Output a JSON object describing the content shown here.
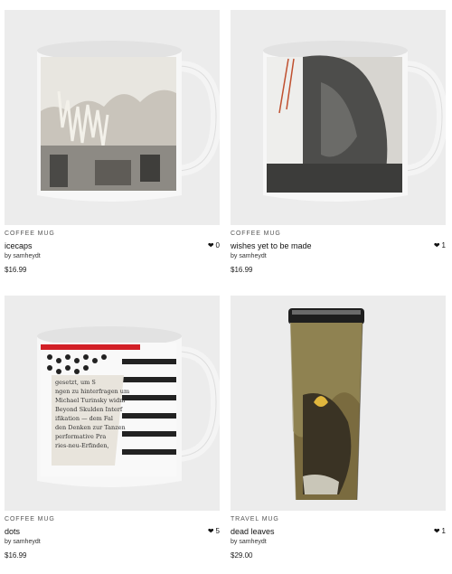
{
  "products": [
    {
      "type": "COFFEE MUG",
      "title": "icecaps",
      "by": "by samheydt",
      "price": "$16.99",
      "likes": "0",
      "image": "mug-icecaps"
    },
    {
      "type": "COFFEE MUG",
      "title": "wishes yet to be made",
      "by": "by samheydt",
      "price": "$16.99",
      "likes": "1",
      "image": "mug-wishes"
    },
    {
      "type": "COFFEE MUG",
      "title": "dots",
      "by": "by samheydt",
      "price": "$16.99",
      "likes": "5",
      "image": "mug-dots"
    },
    {
      "type": "TRAVEL MUG",
      "title": "dead leaves",
      "by": "by samheydt",
      "price": "$29.00",
      "likes": "1",
      "image": "travel-mug-dead-leaves"
    }
  ],
  "mug_dots_print": {
    "line1": "gesetzt, um S",
    "line2": "ngen zu hinterfragen um",
    "line3": "Michael Turinsky widm",
    "line4": "Beyond Skulden Interf",
    "line5": "ifikation — dem Fal",
    "line6": "den Denken zur Tanzen",
    "line7": "performative Pra",
    "line8": "ries-neu-Erfinden,"
  },
  "icons": {
    "like": "heart-icon"
  },
  "colors": {
    "text": "#1c1c1c",
    "muted": "#555555",
    "tile": "#ececec"
  }
}
